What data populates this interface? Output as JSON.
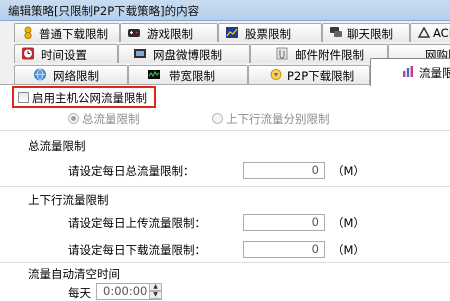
{
  "window": {
    "title": "编辑策略[只限制P2P下载策略]的内容"
  },
  "tabs": {
    "row1": [
      {
        "label": "普通下载限制",
        "icon": "download-gourd-icon",
        "color": "#e8a400"
      },
      {
        "label": "游戏限制",
        "icon": "game-icon",
        "color": "#222222"
      },
      {
        "label": "股票限制",
        "icon": "stock-icon",
        "color": "#203a8c"
      },
      {
        "label": "聊天限制",
        "icon": "chat-icon",
        "color": "#3a3a3a"
      },
      {
        "label": "ACL",
        "icon": "acl-icon",
        "color": "#333333"
      }
    ],
    "row2": [
      {
        "label": "时间设置",
        "icon": "clock-icon",
        "color": "#c1272d"
      },
      {
        "label": "网盘微博限制",
        "icon": "cloud-disk-icon",
        "color": "#2f2f2f"
      },
      {
        "label": "邮件附件限制",
        "icon": "mail-attachment-icon",
        "color": "#7a7a7a"
      },
      {
        "label": "网购限",
        "icon": "shopping-icon",
        "color": "#333333"
      }
    ],
    "row3": [
      {
        "label": "网络限制",
        "icon": "network-icon",
        "color": "#3a7fd5"
      },
      {
        "label": "带宽限制",
        "icon": "bandwidth-icon",
        "color": "#1f6b2e"
      },
      {
        "label": "P2P下载限制",
        "icon": "p2p-icon",
        "color": "#3b6fc7"
      },
      {
        "label": "流量限",
        "icon": "traffic-icon",
        "color": "#c33c8a",
        "active": true
      }
    ]
  },
  "content": {
    "enable_checkbox_label": "启用主机公网流量限制",
    "radio_total": "总流量限制",
    "radio_split": "上下行流量分别限制",
    "section_total": "总流量限制",
    "daily_total_label": "请设定每日总流量限制：",
    "daily_total_value": "0",
    "unit_m": "（M）",
    "section_updown": "上下行流量限制",
    "daily_upload_label": "请设定每日上传流量限制：",
    "daily_upload_value": "0",
    "daily_download_label": "请设定每日下载流量限制：",
    "daily_download_value": "0",
    "section_autoclear": "流量自动清空时间",
    "every_day_label": "每天",
    "time_value": "0:00:00"
  },
  "colors": {
    "highlight": "#e0261b"
  }
}
